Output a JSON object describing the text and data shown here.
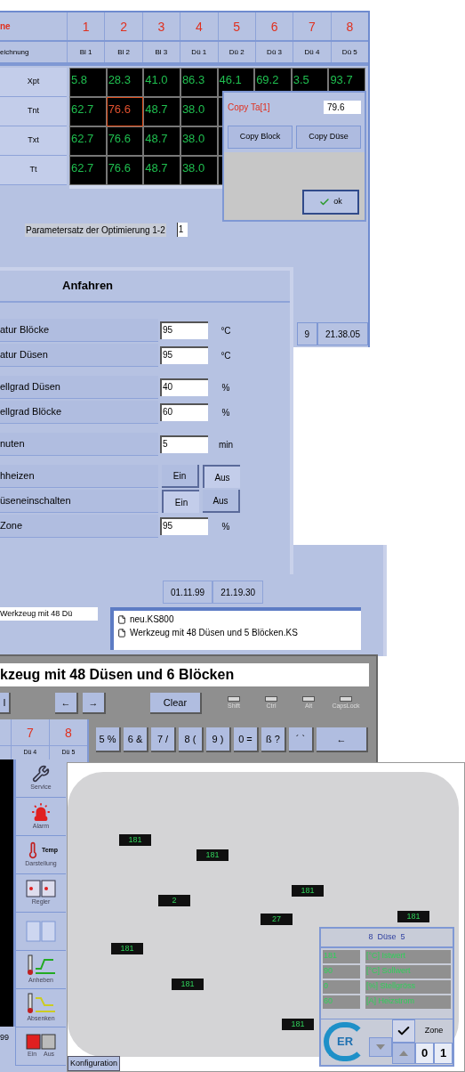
{
  "param_window": {
    "header_label": "ne",
    "name_label": "eichnung",
    "columns": [
      {
        "number": "1",
        "name": "Bl 1"
      },
      {
        "number": "2",
        "name": "Bl 2"
      },
      {
        "number": "3",
        "name": "Bl 3"
      },
      {
        "number": "4",
        "name": "Dü 1"
      },
      {
        "number": "5",
        "name": "Dü 2"
      },
      {
        "number": "6",
        "name": "Dü 3"
      },
      {
        "number": "7",
        "name": "Dü 4"
      },
      {
        "number": "8",
        "name": "Dü 5"
      }
    ],
    "grid_rows": [
      {
        "label": "Xpt",
        "cells": [
          {
            "text": "5.8",
            "selected": false
          },
          {
            "text": "28.3",
            "selected": false
          },
          {
            "text": "41.0",
            "selected": false
          },
          {
            "text": "86.3",
            "selected": false
          },
          {
            "text": "46.1",
            "selected": false
          },
          {
            "text": "69.2",
            "selected": false
          },
          {
            "text": "3.5",
            "selected": false
          },
          {
            "text": "93.7",
            "selected": false
          }
        ]
      },
      {
        "label": "Tnt",
        "cells": [
          {
            "text": "62.7",
            "selected": false
          },
          {
            "text": "76.6",
            "selected": true
          },
          {
            "text": "48.7",
            "selected": false
          },
          {
            "text": "38.0",
            "selected": false
          }
        ]
      },
      {
        "label": "Txt",
        "cells": [
          {
            "text": "62.7",
            "selected": false
          },
          {
            "text": "76.6",
            "selected": false
          },
          {
            "text": "48.7",
            "selected": false
          },
          {
            "text": "38.0",
            "selected": false
          }
        ]
      },
      {
        "label": "Tt",
        "cells": [
          {
            "text": "62.7",
            "selected": false
          },
          {
            "text": "76.6",
            "selected": false
          },
          {
            "text": "48.7",
            "selected": false
          },
          {
            "text": "38.0",
            "selected": false
          }
        ]
      }
    ],
    "copy_dialog": {
      "title": "Copy Ta[1]",
      "value": "79.6",
      "buttons": [
        "Copy Block",
        "Copy Düse"
      ],
      "ok": "ok"
    },
    "parameter_set": {
      "label": "Parametersatz der Optimierung 1-2",
      "value": "1"
    },
    "status": [
      "9",
      "21.38.05"
    ]
  },
  "startup_window": {
    "title": "Anfahren",
    "groups": [
      [
        {
          "kind": "input",
          "label": "atur Blöcke",
          "value": "95",
          "unit": "°C"
        },
        {
          "kind": "input",
          "label": "atur Düsen",
          "value": "95",
          "unit": "°C"
        }
      ],
      [
        {
          "kind": "input",
          "label": "ellgrad Düsen",
          "value": "40",
          "unit": "%"
        },
        {
          "kind": "input",
          "label": "ellgrad Blöcke",
          "value": "60",
          "unit": "%"
        }
      ],
      [
        {
          "kind": "input",
          "label": "nuten",
          "value": "5",
          "unit": "min"
        }
      ],
      [
        {
          "kind": "toggle",
          "label": "hheizen",
          "options": [
            {
              "label": "Ein",
              "selected": false
            },
            {
              "label": "Aus",
              "selected": true
            }
          ]
        },
        {
          "kind": "toggle",
          "label": "üseneinschalten",
          "options": [
            {
              "label": "Ein",
              "selected": true
            },
            {
              "label": "Aus",
              "selected": false
            }
          ]
        },
        {
          "kind": "input",
          "label": "Zone",
          "value": "95",
          "unit": "%"
        }
      ]
    ]
  },
  "file_window": {
    "status": [
      "01.11.99",
      "21.19.30"
    ],
    "name_field": "Werkzeug mit 48 Dü",
    "files": [
      "neu.KS800",
      "Werkzeug mit 48 Düsen und 5 Blöcken.KS"
    ]
  },
  "keyboard_window": {
    "text": "kzeug mit 48 Düsen und 6 Blöcken",
    "cut_key": "l",
    "arrow_keys": [
      "←",
      "→"
    ],
    "clear": "Clear",
    "indicators": [
      {
        "label": "Shift",
        "on": false
      },
      {
        "label": "Ctrl",
        "on": false
      },
      {
        "label": "Alt",
        "on": false
      },
      {
        "label": "CapsLock",
        "on": false
      }
    ],
    "keys": [
      "5 %",
      "6 &",
      "7 /",
      "8 (",
      "9 )",
      "0 =",
      "ß ?",
      "´ `",
      "←"
    ]
  },
  "zone_window": {
    "columns": [
      {
        "number": "7",
        "name": "Dü 4"
      },
      {
        "number": "8",
        "name": "Dü 5"
      }
    ],
    "tools": [
      {
        "kind": "service",
        "labels": [
          "Service"
        ]
      },
      {
        "kind": "alarm",
        "labels": [
          "Alarm"
        ]
      },
      {
        "kind": "display",
        "labels": [
          "Darstellung"
        ],
        "icon_text": "Temp"
      },
      {
        "kind": "controller",
        "labels": [
          "Regler"
        ]
      },
      {
        "kind": "extra"
      },
      {
        "kind": "raise",
        "labels": [
          "Anheben"
        ]
      },
      {
        "kind": "lower",
        "labels": [
          "Absenken"
        ]
      },
      {
        "kind": "power",
        "labels": [
          "Ein",
          "Aus"
        ]
      }
    ],
    "status": "99"
  },
  "machine_window": {
    "labels": [
      "181",
      "181",
      "2",
      "181",
      "27",
      "181",
      "181",
      "181",
      "181"
    ],
    "info": {
      "title": "8  Düse  5",
      "rows": [
        {
          "value": "181",
          "label": "[°C] Istwert"
        },
        {
          "value": "90",
          "label": "[°C] Sollwert"
        },
        {
          "value": "0",
          "label": "[%] Stellgröss"
        },
        {
          "value": "60",
          "label": "[A] Heizstrom"
        }
      ],
      "logo": "ER",
      "zone_label": "Zone",
      "zone_digits": [
        "0",
        "1"
      ]
    },
    "config_button": "Konfiguration"
  }
}
